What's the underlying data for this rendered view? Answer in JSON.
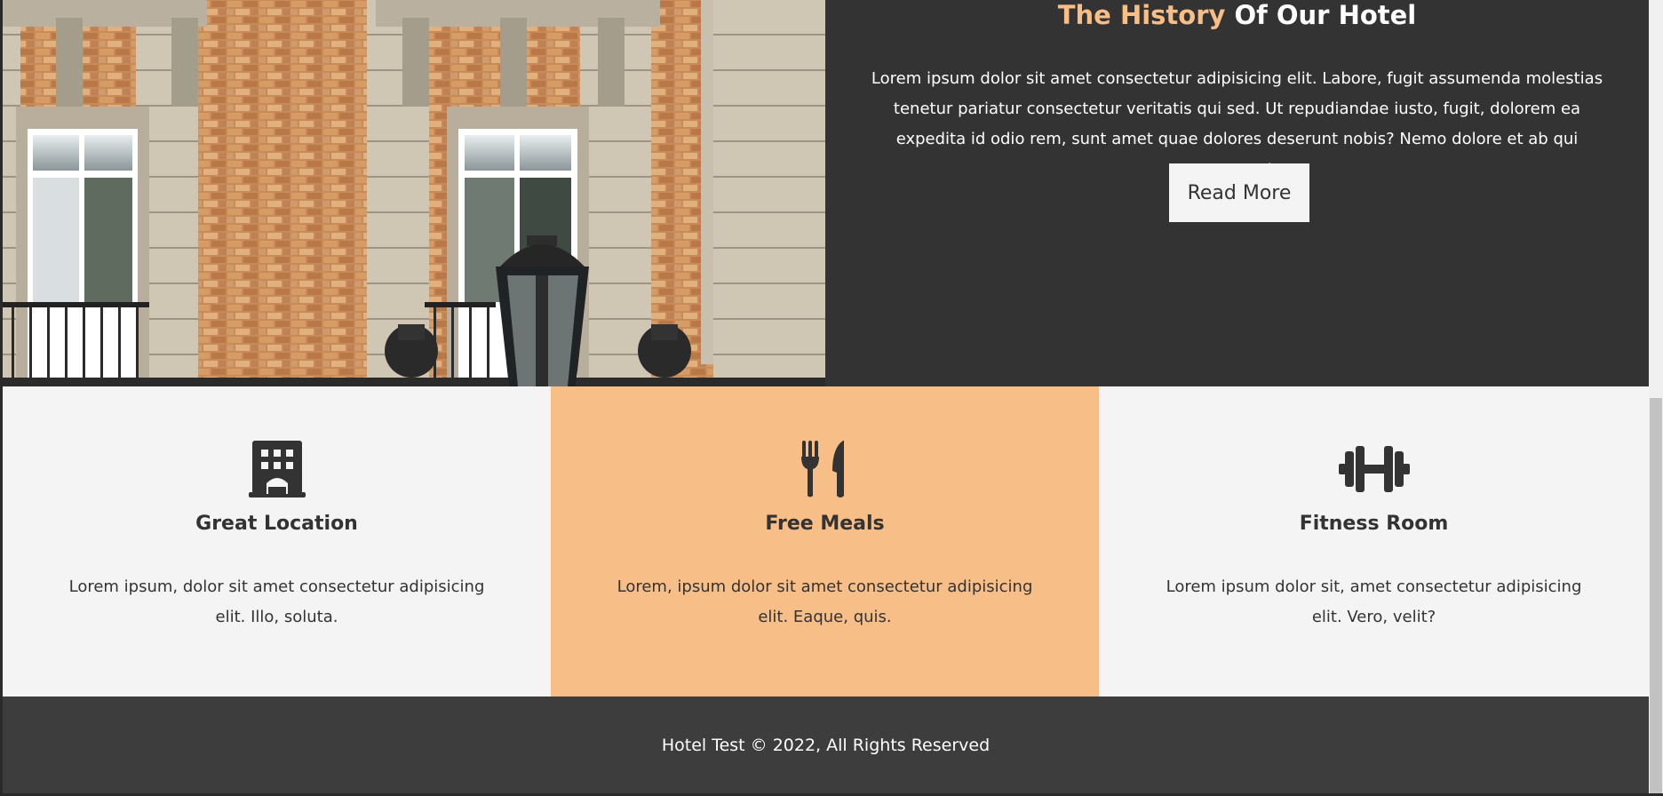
{
  "about": {
    "title_accent": "The History",
    "title_rest": "Of Our Hotel",
    "body": "Lorem ipsum dolor sit amet consectetur adipisicing elit. Labore, fugit assumenda molestias tenetur pariatur consectetur veritatis qui sed. Ut repudiandae iusto, fugit, dolorem ea expedita id odio rem, sunt amet quae dolores deserunt nobis? Nemo dolore et ab qui consequuntur.",
    "button_label": "Read More"
  },
  "features": [
    {
      "icon": "building-icon",
      "title": "Great Location",
      "text": "Lorem ipsum, dolor sit amet consectetur adipisicing elit. Illo, soluta."
    },
    {
      "icon": "utensils-icon",
      "title": "Free Meals",
      "text": "Lorem, ipsum dolor sit amet consectetur adipisicing elit. Eaque, quis."
    },
    {
      "icon": "dumbbell-icon",
      "title": "Fitness Room",
      "text": "Lorem ipsum dolor sit, amet consectetur adipisicing elit. Vero, velit?"
    }
  ],
  "footer": {
    "text": "Hotel Test © 2022, All Rights Reserved"
  },
  "colors": {
    "accent": "#f7be88",
    "dark": "#333333",
    "light": "#f4f4f4",
    "footer": "#3d3d3d"
  }
}
